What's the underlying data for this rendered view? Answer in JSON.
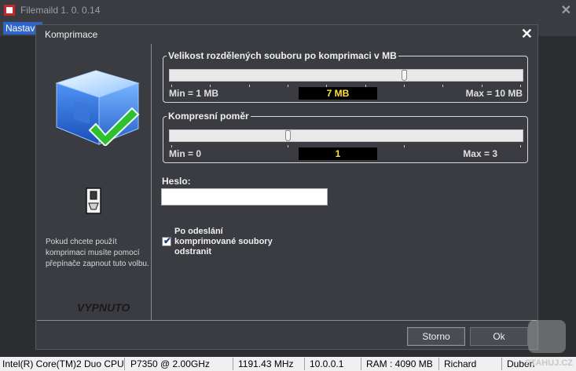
{
  "app": {
    "title": "Filemaild  1. 0. 0.14",
    "menu_item": "Nastave"
  },
  "dialog": {
    "title": "Komprimace",
    "size_group": {
      "title": "Velikost rozdělených souboru po komprimaci v MB",
      "min": "Min = 1 MB",
      "max": "Max = 10 MB",
      "value": "7 MB",
      "fraction": 0.667
    },
    "ratio_group": {
      "title": "Kompresní poměr",
      "min": "Min = 0",
      "max": "Max = 3",
      "value": "1",
      "fraction": 0.333
    },
    "password_label": "Heslo:",
    "password_value": "",
    "checkbox_label": "Po odeslání komprimované soubory odstranit",
    "checkbox_checked": true,
    "hint": "Pokud chcete použít komprimaci musíte pomocí přepínače zapnout tuto volbu.",
    "status": "VYPNUTO",
    "buttons": {
      "cancel": "Storno",
      "ok": "Ok"
    }
  },
  "status_bar": {
    "cpu": "Intel(R) Core(TM)2 Duo CPU",
    "model": "P7350  @ 2.00GHz",
    "mhz": "1191.43 MHz",
    "version": "10.0.0.1",
    "ram": "RAM : 4090 MB",
    "user": "Richard",
    "month": "Duben"
  },
  "watermark": "STAHUJ.CZ",
  "colors": {
    "accent": "#2f65c9",
    "value_text": "#ffe33a"
  }
}
